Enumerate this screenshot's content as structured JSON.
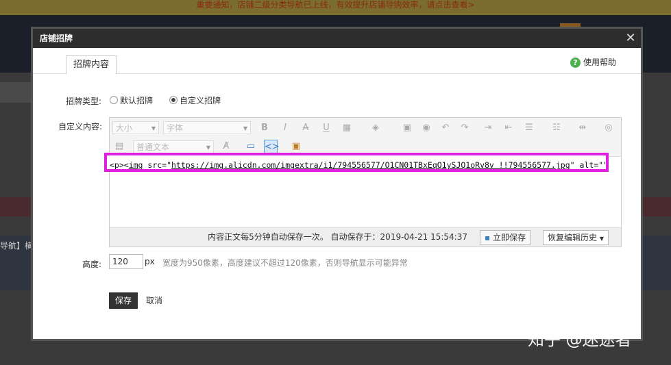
{
  "background": {
    "notice_text": "重要通知，店铺二级分类导航已上线，有效提升店铺导购效率，请点击查看>",
    "left_text": "导航】横"
  },
  "dialog": {
    "title": "店铺招牌",
    "close_icon": "close-icon",
    "tab_label": "招牌内容",
    "help_label": "使用帮助",
    "type_label": "招牌类型:",
    "radio_default": "默认招牌",
    "radio_custom": "自定义招牌",
    "custom_content_label": "自定义内容:",
    "toolbar": {
      "font_size_placeholder": "大小",
      "font_family_placeholder": "字体",
      "format_placeholder": "普通文本"
    },
    "code_prefix": "<p><",
    "code_img": "img",
    "code_src_attr": " src=\"",
    "code_url": "https://img.alicdn.com/imgextra/i1/794556577/O1CN01TBxEqQ1ySJQ1oRv8v_!!794556577.jpg",
    "code_suffix": "\" alt=\"\" /> </p>",
    "status_text": "内容正文每5分钟自动保存一次。  自动保存于：2019-04-21 15:54:37",
    "save_now_label": "立即保存",
    "history_label": "恢复编辑历史",
    "height_label": "高度:",
    "height_value": "120",
    "height_unit": "px",
    "height_hint": "宽度为950像素，高度建议不超过120像素，否则导航显示可能异常",
    "save_label": "保存",
    "cancel_label": "取消"
  },
  "watermark": "知乎 @迷途者"
}
